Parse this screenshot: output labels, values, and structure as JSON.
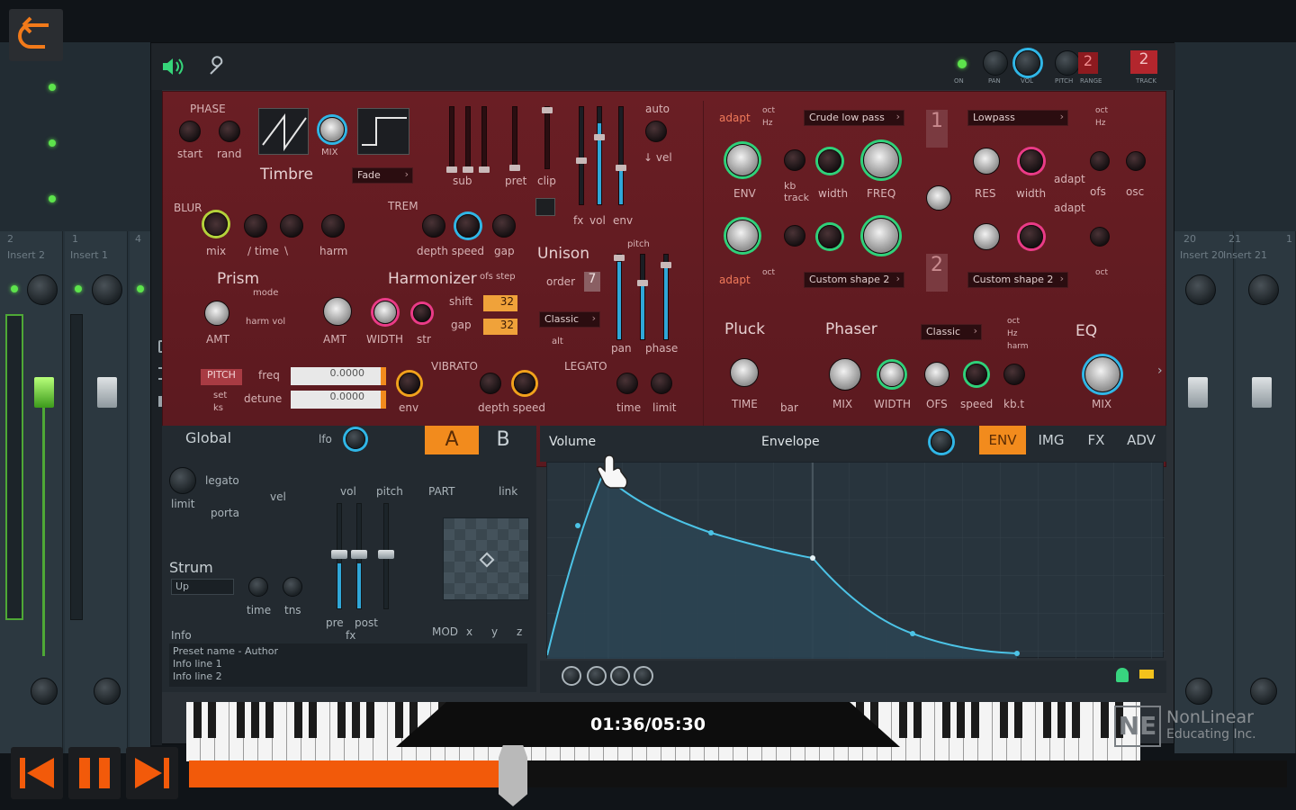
{
  "player": {
    "time_display": "01:36/05:30",
    "progress_fraction": 0.295,
    "watermark_line1": "NonLinear",
    "watermark_line2": "Educating Inc.",
    "colors": {
      "accent": "#f25a0a"
    }
  },
  "mixer": {
    "left_inserts": [
      "Insert 2",
      "Insert 1"
    ],
    "left_numbers": [
      "2",
      "1",
      "4"
    ],
    "right_inserts": [
      "Insert 20",
      "Insert 21"
    ],
    "right_numbers": [
      "20",
      "21",
      "1"
    ]
  },
  "plugin": {
    "top": {
      "labels": [
        "ON",
        "PAN",
        "VOL",
        "PITCH",
        "RANGE",
        "TRACK"
      ],
      "range_value": "2",
      "track_value": "2"
    },
    "osc": {
      "phase": "PHASE",
      "start": "start",
      "rand": "rand",
      "mix": "MIX",
      "timbre": "Timbre",
      "fade": "Fade",
      "sub": "sub",
      "pret": "pret",
      "clip": "clip",
      "auto": "auto",
      "vel": "↓ vel",
      "fx": "fx",
      "vol": "vol",
      "env": "env"
    },
    "blur": {
      "title": "BLUR",
      "mix": "mix",
      "time": "∕ time ∖",
      "harm": "harm"
    },
    "trem": {
      "title": "TREM",
      "depth_speed": "depth speed",
      "gap": "gap"
    },
    "unison": {
      "title": "Unison",
      "order": "order",
      "order_value": "7",
      "classic": "Classic",
      "alt": "alt",
      "pitch": "pitch",
      "pan": "pan",
      "phase": "phase"
    },
    "prism": {
      "title": "Prism",
      "mode": "mode",
      "harm_vol": "harm vol",
      "amt": "AMT"
    },
    "harmonizer": {
      "title": "Harmonizer",
      "ofs_step": "ofs step",
      "shift": "shift",
      "gap": "gap",
      "shift_value": "32",
      "gap_value": "32",
      "amt": "AMT",
      "width": "WIDTH",
      "str": "str"
    },
    "pitch": {
      "title": "PITCH",
      "freq": "freq",
      "detune": "detune",
      "freq_value": "0.0000",
      "detune_value": "0.0000",
      "set": "set",
      "ks": "ks",
      "env": "env"
    },
    "vibrato": {
      "title": "VIBRATO",
      "depth_speed": "depth speed"
    },
    "legato": {
      "title": "LEGATO",
      "time": "time",
      "limit": "limit"
    },
    "filter1": {
      "adapt": "adapt",
      "oct": "oct",
      "hz": "Hz",
      "type": "Crude low pass",
      "env": "ENV",
      "kb_track": "kb\ntrack",
      "width": "width",
      "freq": "FREQ",
      "custom": "Custom shape 2"
    },
    "filter2": {
      "type": "Lowpass",
      "res": "RES",
      "width": "width",
      "adapt": "adapt",
      "ofs": "ofs",
      "osc": "osc",
      "custom": "Custom shape 2",
      "oct": "oct",
      "hz": "Hz"
    },
    "fx": {
      "pluck": "Pluck",
      "time": "TIME",
      "bar": "bar",
      "phaser": "Phaser",
      "classic": "Classic",
      "oct": "oct",
      "hz": "Hz",
      "harm": "harm",
      "mix": "MIX",
      "width": "WIDTH",
      "ofs": "OFS",
      "speed": "speed",
      "kb": "kb.t",
      "eq": "EQ",
      "eq_mix": "MIX"
    },
    "global": {
      "title": "Global",
      "lfo": "lfo",
      "legato": "legato",
      "vel": "vel",
      "porta": "porta",
      "limit": "limit",
      "strum": "Strum",
      "up": "Up",
      "time": "time",
      "tns": "tns",
      "info": "Info",
      "info_lines": [
        "Preset name - Author",
        "Info line 1",
        "Info line 2"
      ]
    },
    "layer": {
      "a": "A",
      "b": "B",
      "vol": "vol",
      "pitch": "pitch",
      "part": "PART",
      "link": "link",
      "pre": "pre",
      "post": "post",
      "fx": "fx",
      "mod": "MOD",
      "x": "x",
      "y": "y",
      "z": "z"
    },
    "env": {
      "target": "Volume",
      "mode": "Envelope",
      "tabs": [
        "ENV",
        "IMG",
        "FX",
        "ADV"
      ],
      "active_tab": "ENV"
    }
  }
}
